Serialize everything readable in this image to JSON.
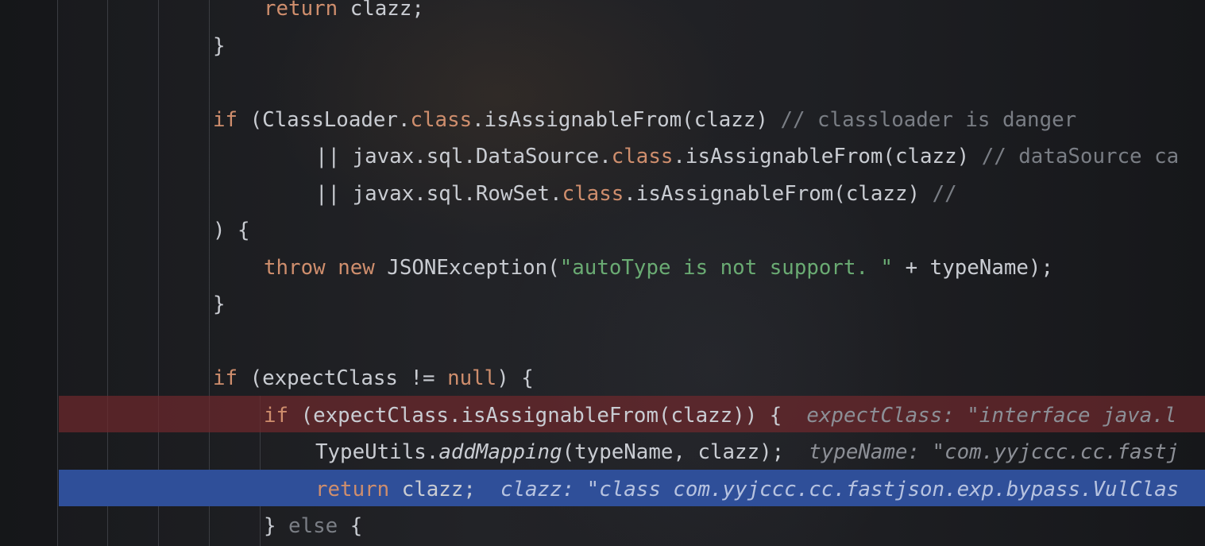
{
  "editor": {
    "lines": [
      {
        "indent": "l2",
        "segments": [
          {
            "t": "return",
            "c": "kw"
          },
          {
            "t": " clazz;",
            "c": "plain"
          }
        ]
      },
      {
        "indent": "l1",
        "segments": [
          {
            "t": "}",
            "c": "plain"
          }
        ]
      },
      {
        "indent": "l1",
        "segments": []
      },
      {
        "indent": "l1",
        "segments": [
          {
            "t": "if",
            "c": "kw"
          },
          {
            "t": " (ClassLoader.",
            "c": "plain"
          },
          {
            "t": "class",
            "c": "kw"
          },
          {
            "t": ".isAssignableFrom(clazz) ",
            "c": "plain"
          },
          {
            "t": "// classloader is danger",
            "c": "cmt"
          }
        ]
      },
      {
        "indent": "l3",
        "segments": [
          {
            "t": "|| javax.sql.DataSource.",
            "c": "plain"
          },
          {
            "t": "class",
            "c": "kw"
          },
          {
            "t": ".isAssignableFrom(clazz) ",
            "c": "plain"
          },
          {
            "t": "// dataSource ca",
            "c": "cmt"
          }
        ]
      },
      {
        "indent": "l3",
        "segments": [
          {
            "t": "|| javax.sql.RowSet.",
            "c": "plain"
          },
          {
            "t": "class",
            "c": "kw"
          },
          {
            "t": ".isAssignableFrom(clazz) ",
            "c": "plain"
          },
          {
            "t": "//",
            "c": "cmt"
          }
        ]
      },
      {
        "indent": "l1",
        "segments": [
          {
            "t": ") {",
            "c": "plain"
          }
        ]
      },
      {
        "indent": "l2",
        "segments": [
          {
            "t": "throw",
            "c": "kw"
          },
          {
            "t": " ",
            "c": "plain"
          },
          {
            "t": "new",
            "c": "kw"
          },
          {
            "t": " JSONException(",
            "c": "plain"
          },
          {
            "t": "\"autoType is not support. \"",
            "c": "str"
          },
          {
            "t": " + typeName);",
            "c": "plain"
          }
        ]
      },
      {
        "indent": "l1",
        "segments": [
          {
            "t": "}",
            "c": "plain"
          }
        ]
      },
      {
        "indent": "l1",
        "segments": []
      },
      {
        "indent": "l1",
        "segments": [
          {
            "t": "if",
            "c": "kw"
          },
          {
            "t": " (expectClass != ",
            "c": "plain"
          },
          {
            "t": "null",
            "c": "kw"
          },
          {
            "t": ") {",
            "c": "plain"
          }
        ]
      },
      {
        "indent": "l2",
        "segments": [
          {
            "t": "if",
            "c": "kw"
          },
          {
            "t": " (expectClass.isAssignableFrom(clazz)) {",
            "c": "plain"
          },
          {
            "t": "  expectClass: \"interface java.l",
            "c": "hint"
          }
        ]
      },
      {
        "indent": "l3",
        "segments": [
          {
            "t": "TypeUtils.",
            "c": "plain"
          },
          {
            "t": "addMapping",
            "c": "fn-it"
          },
          {
            "t": "(typeName, clazz);",
            "c": "plain"
          },
          {
            "t": "  typeName: \"com.yyjccc.cc.fastj",
            "c": "hint"
          }
        ]
      },
      {
        "indent": "l3",
        "segments": [
          {
            "t": "return",
            "c": "kw"
          },
          {
            "t": " clazz;",
            "c": "plain"
          },
          {
            "t": "  clazz: \"class com.yyjccc.cc.fastjson.exp.bypass.VulClas",
            "c": "hint-exec"
          }
        ]
      },
      {
        "indent": "l2",
        "segments": [
          {
            "t": "}",
            "c": "plain"
          },
          {
            "t": " else ",
            "c": "cmt"
          },
          {
            "t": "{",
            "c": "plain"
          }
        ]
      }
    ]
  }
}
